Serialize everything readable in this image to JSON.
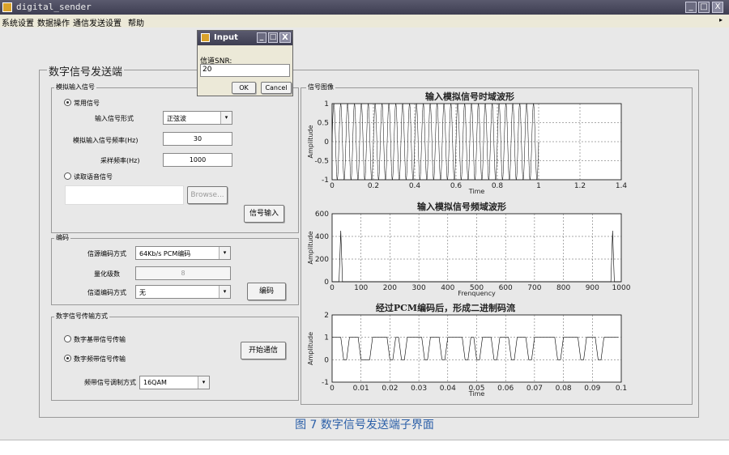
{
  "window": {
    "title": "digital_sender",
    "minimize": "_",
    "maximize": "□",
    "close": "X"
  },
  "menu": {
    "items": [
      "系统设置",
      "数据操作",
      "通信发送设置",
      "帮助"
    ]
  },
  "panel": {
    "title": "数字信号发送端"
  },
  "analog": {
    "group_label": "模拟输入信号",
    "radio_common": "常用信号",
    "form_label": "输入信号形式",
    "form_value": "正弦波",
    "freq_label": "模拟输入信号频率(Hz)",
    "freq_value": "30",
    "sample_label": "采样频率(Hz)",
    "sample_value": "1000",
    "radio_voice": "读取语音信号",
    "browse": "Browse...",
    "signal_input": "信号输入"
  },
  "encoding": {
    "group_label": "编码",
    "source_label": "信源编码方式",
    "source_value": "64Kb/s PCM编码",
    "quant_label": "量化级数",
    "quant_value": "8",
    "channel_label": "信道编码方式",
    "channel_value": "无",
    "encode_button": "编码"
  },
  "transmit": {
    "group_label": "数字信号传输方式",
    "radio_base": "数字基带信号传输",
    "radio_band": "数字频带信号传输",
    "mod_label": "频带信号调制方式",
    "mod_value": "16QAM",
    "start_button": "开始通信"
  },
  "signal_group": {
    "label": "信号图像"
  },
  "dialog": {
    "title": "Input",
    "prompt": "信道SNR:",
    "value": "20",
    "ok": "OK",
    "cancel": "Cancel"
  },
  "caption": "图 7 数字信号发送端子界面",
  "chart_data": [
    {
      "type": "line",
      "title": "输入模拟信号时域波形",
      "xlabel": "Time",
      "ylabel": "Amplitude",
      "xlim": [
        0,
        1.4
      ],
      "ylim": [
        -1,
        1
      ],
      "xticks": [
        "0",
        "0.2",
        "0.4",
        "0.6",
        "0.8",
        "1",
        "1.2",
        "1.4"
      ],
      "yticks": [
        "-1",
        "-0.5",
        "0",
        "0.5",
        "1"
      ],
      "series": [
        {
          "frequency": 30,
          "x_end": 1.0
        }
      ],
      "grid": true
    },
    {
      "type": "line",
      "title": "输入模拟信号频域波形",
      "xlabel": "Frenquency",
      "ylabel": "Amplitude",
      "xlim": [
        0,
        1000
      ],
      "ylim": [
        0,
        600
      ],
      "xticks": [
        "0",
        "100",
        "200",
        "300",
        "400",
        "500",
        "600",
        "700",
        "800",
        "900",
        "1000"
      ],
      "yticks": [
        "0",
        "200",
        "400",
        "600"
      ],
      "series": [
        {
          "peaks": [
            [
              30,
              450
            ],
            [
              970,
              450
            ]
          ]
        }
      ],
      "grid": true
    },
    {
      "type": "line",
      "title": "经过PCM编码后，形成二进制码流",
      "xlabel": "Time",
      "ylabel": "Amplitude",
      "xlim": [
        0,
        0.1
      ],
      "ylim": [
        -1,
        2
      ],
      "xticks": [
        "0",
        "0.01",
        "0.02",
        "0.03",
        "0.04",
        "0.05",
        "0.06",
        "0.07",
        "0.08",
        "0.09",
        "0.1"
      ],
      "yticks": [
        "-1",
        "0",
        "1",
        "2"
      ],
      "series": [
        {
          "bits": [
            1,
            1,
            0,
            1,
            1,
            0,
            0,
            1,
            1,
            1,
            0,
            1,
            0,
            1,
            1,
            1,
            0,
            1,
            1,
            0,
            1,
            1,
            1,
            0,
            1,
            0,
            1,
            1,
            0,
            1,
            1,
            0,
            1,
            1,
            0,
            1,
            1,
            1,
            1,
            0,
            1,
            1,
            1,
            0,
            1,
            1,
            0,
            1,
            1,
            1
          ]
        }
      ],
      "grid": true
    }
  ]
}
